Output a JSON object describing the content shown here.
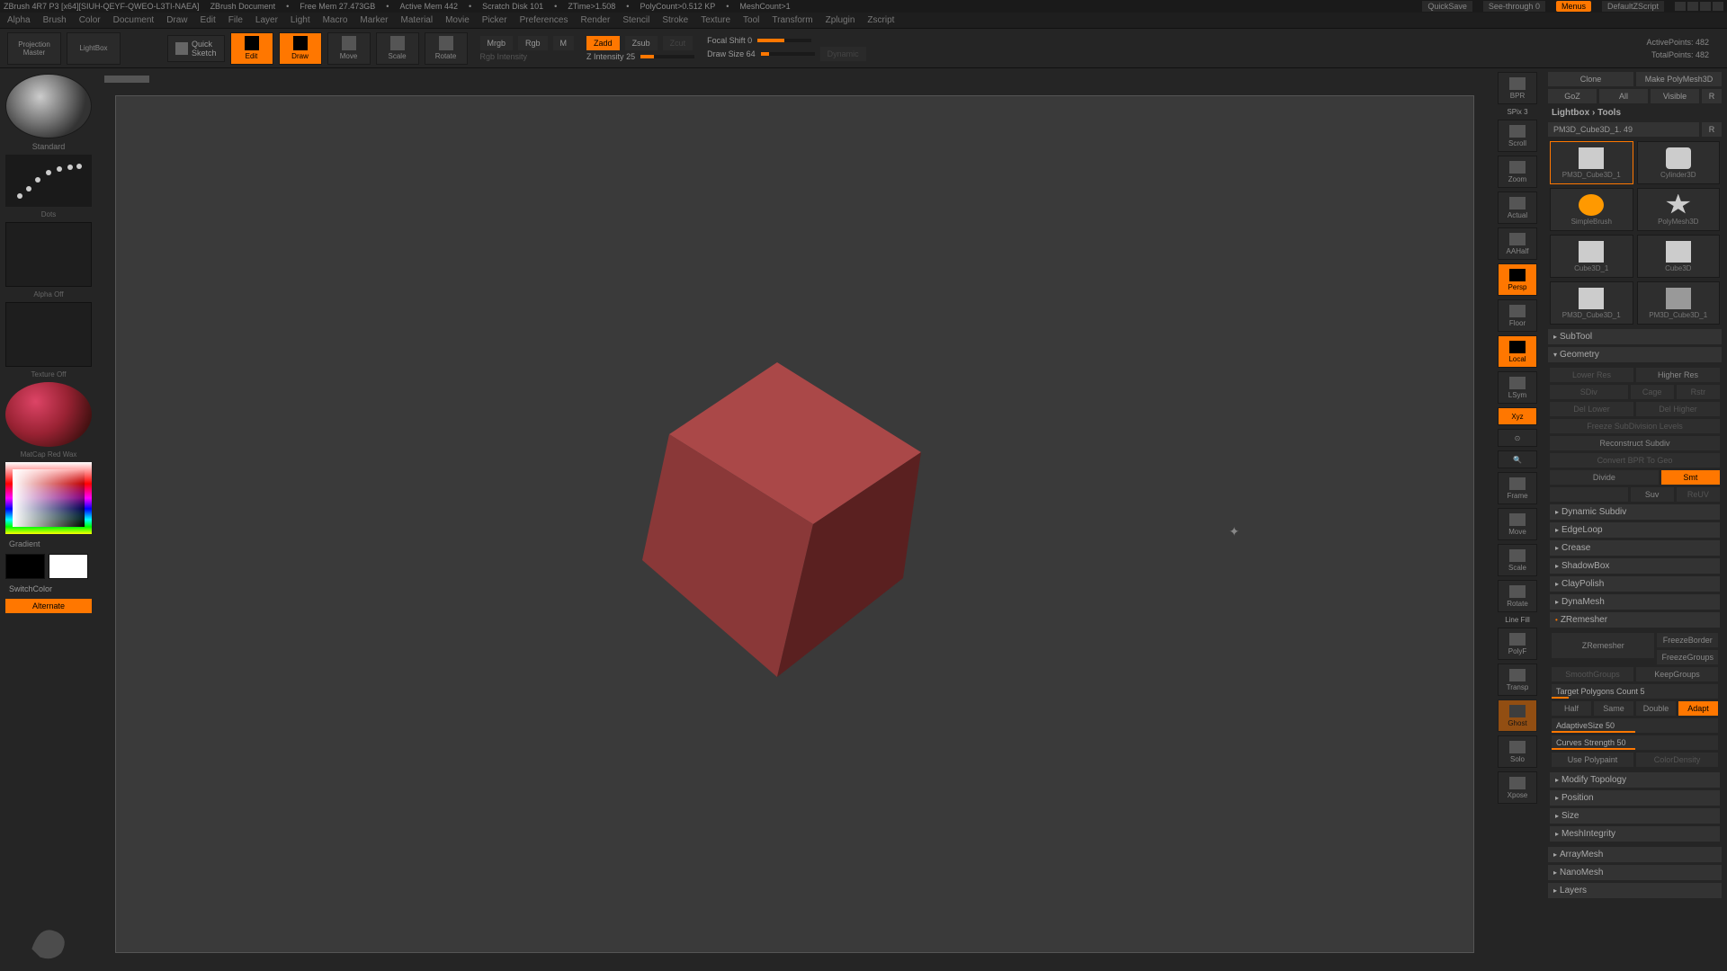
{
  "title": {
    "app": "ZBrush 4R7 P3 [x64][SIUH-QEYF-QWEO-L3TI-NAEA]",
    "doc": "ZBrush Document",
    "freemem": "Free Mem 27.473GB",
    "activemem": "Active Mem 442",
    "scratch": "Scratch Disk 101",
    "ztime": "ZTime>1.508",
    "polycount": "PolyCount>0.512 KP",
    "meshcount": "MeshCount>1",
    "quicksave": "QuickSave",
    "seethrough": "See-through   0",
    "menus": "Menus",
    "defaultzscript": "DefaultZScript"
  },
  "menu": [
    "Alpha",
    "Brush",
    "Color",
    "Document",
    "Draw",
    "Edit",
    "File",
    "Layer",
    "Light",
    "Macro",
    "Marker",
    "Material",
    "Movie",
    "Picker",
    "Preferences",
    "Render",
    "Stencil",
    "Stroke",
    "Texture",
    "Tool",
    "Transform",
    "Zplugin",
    "Zscript"
  ],
  "toolbar": {
    "projection": "Projection\nMaster",
    "lightbox": "LightBox",
    "quicksketch": "Quick\nSketch",
    "edit": "Edit",
    "draw": "Draw",
    "move": "Move",
    "scale": "Scale",
    "rotate": "Rotate",
    "mrgb": "Mrgb",
    "rgb": "Rgb",
    "m": "M",
    "rgb_intensity_label": "Rgb Intensity",
    "zadd": "Zadd",
    "zsub": "Zsub",
    "zcut": "Zcut",
    "z_intensity": "Z Intensity 25",
    "focal_shift": "Focal Shift 0",
    "draw_size": "Draw Size 64",
    "dynamic": "Dynamic",
    "active_points": "ActivePoints: 482",
    "total_points": "TotalPoints: 482"
  },
  "left": {
    "brush": "Standard",
    "stroke": "Dots",
    "alpha": "Alpha Off",
    "texture": "Texture Off",
    "material": "MatCap Red Wax",
    "gradient": "Gradient",
    "switchcolor": "SwitchColor",
    "alternate": "Alternate"
  },
  "right_tools": {
    "bpr": "BPR",
    "spix": "SPix 3",
    "scroll": "Scroll",
    "zoom": "Zoom",
    "actual": "Actual",
    "aahalf": "AAHalf",
    "persp": "Persp",
    "floor": "Floor",
    "local": "Local",
    "lsym": "LSym",
    "xyz": "Xyz",
    "frame": "Frame",
    "move": "Move",
    "scale": "Scale",
    "rotate": "Rotate",
    "linefill": "Line Fill",
    "polyf": "PolyF",
    "transp": "Transp",
    "ghost": "Ghost",
    "solo": "Solo",
    "xpose": "Xpose"
  },
  "rp": {
    "goz": "GoZ",
    "all": "All",
    "visible": "Visible",
    "r": "R",
    "lightbox_tools": "Lightbox › Tools",
    "current_tool": "PM3D_Cube3D_1. 49",
    "clone": "Clone",
    "make_polymesh": "Make PolyMesh3D",
    "tools": [
      {
        "name": "PM3D_Cube3D_1"
      },
      {
        "name": "Cylinder3D"
      },
      {
        "name": "SimpleBrush"
      },
      {
        "name": "PolyMesh3D"
      },
      {
        "name": "Cube3D_1"
      },
      {
        "name": "Cube3D"
      },
      {
        "name": "PM3D_Cube3D_1"
      },
      {
        "name": "PM3D_Cube3D_1"
      }
    ],
    "subtool": "SubTool",
    "geometry": "Geometry",
    "lower_res": "Lower Res",
    "higher_res": "Higher Res",
    "sdiv": "SDiv",
    "cage": "Cage",
    "rstr": "Rstr",
    "del_lower": "Del Lower",
    "del_higher": "Del Higher",
    "freeze_sub": "Freeze SubDivision Levels",
    "reconstruct": "Reconstruct Subdiv",
    "convert_bpr": "Convert BPR To Geo",
    "divide": "Divide",
    "smt": "Smt",
    "suv": "Suv",
    "resv": "ReUV",
    "dynamic_subdiv": "Dynamic Subdiv",
    "edgeloop": "EdgeLoop",
    "crease": "Crease",
    "shadowbox": "ShadowBox",
    "claypolish": "ClayPolish",
    "dynamesh": "DynaMesh",
    "zremesher": "ZRemesher",
    "zr_btn": "ZRemesher",
    "freezeborder": "FreezeBorder",
    "freezegroups": "FreezeGroups",
    "smoothgroups": "SmoothGroups",
    "keepgroups": "KeepGroups",
    "target_poly": "Target Polygons Count 5",
    "half": "Half",
    "same": "Same",
    "double": "Double",
    "adapt": "Adapt",
    "adaptive": "AdaptiveSize 50",
    "curves_strength": "Curves Strength 50",
    "use_polypaint": "Use Polypaint",
    "colordensity": "ColorDensity",
    "modify_topology": "Modify Topology",
    "position": "Position",
    "size": "Size",
    "meshintegrity": "MeshIntegrity",
    "arraymesh": "ArrayMesh",
    "nanomesh": "NanoMesh",
    "layers": "Layers"
  }
}
